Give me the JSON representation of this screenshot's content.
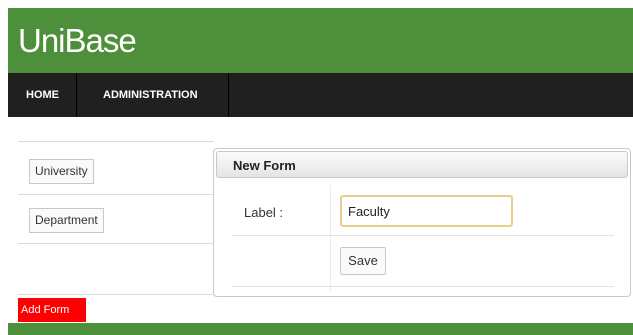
{
  "app": {
    "title": "UniBase"
  },
  "nav": {
    "home": "HOME",
    "administration": "ADMINISTRATION"
  },
  "sidebar": {
    "items": [
      {
        "label": "University"
      },
      {
        "label": "Department"
      }
    ],
    "add_form": "Add Form"
  },
  "dialog": {
    "title": "New Form",
    "label_field": {
      "label": "Label :",
      "value": "Faculty"
    },
    "save": "Save"
  },
  "colors": {
    "brand_green": "#4e8f3c",
    "nav_dark": "#202020",
    "add_form_red": "#ff0000",
    "input_focus_border": "#e8d08a"
  }
}
